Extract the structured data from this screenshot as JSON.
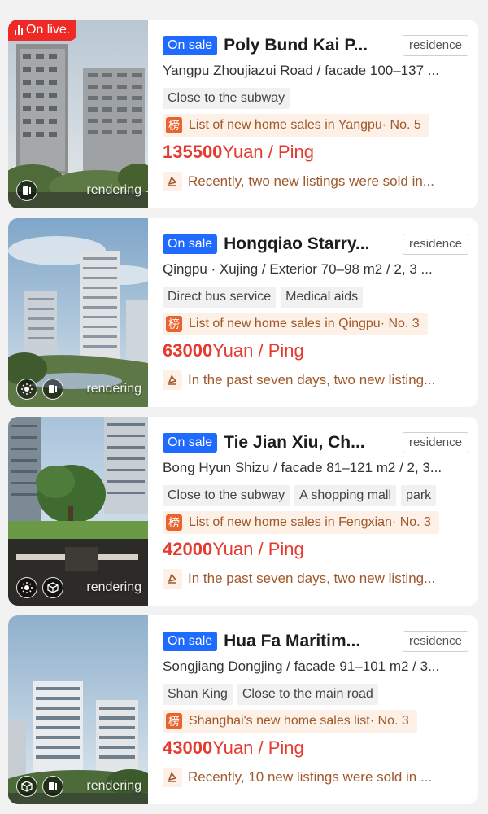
{
  "listings": [
    {
      "live_label": "On live.",
      "render_label": "rendering",
      "status": "On sale",
      "title": "Poly Bund Kai P...",
      "type": "residence",
      "address": "Yangpu Zhoujiazui Road / facade 100–137 ...",
      "tags": [
        "Close to the subway"
      ],
      "rank_icon": "榜",
      "rank_text": "List of new home sales in Yangpu· No. 5",
      "price_value": "135500",
      "price_unit": "Yuan / Ping",
      "news": "Recently, two new listings were sold in..."
    },
    {
      "render_label": "rendering",
      "status": "On sale",
      "title": "Hongqiao Starry...",
      "type": "residence",
      "address": "Qingpu · Xujing / Exterior 70–98 m2 / 2, 3 ...",
      "tags": [
        "Direct bus service",
        "Medical aids"
      ],
      "rank_icon": "榜",
      "rank_text": "List of new home sales in Qingpu· No. 3",
      "price_value": "63000",
      "price_unit": "Yuan / Ping",
      "news": "In the past seven days, two new listing..."
    },
    {
      "render_label": "rendering",
      "status": "On sale",
      "title": "Tie Jian Xiu, Ch...",
      "type": "residence",
      "address": "Bong Hyun Shizu / facade 81–121 m2 / 2, 3...",
      "tags": [
        "Close to the subway",
        "A shopping mall",
        "park"
      ],
      "rank_icon": "榜",
      "rank_text": "List of new home sales in Fengxian· No. 3",
      "price_value": "42000",
      "price_unit": "Yuan / Ping",
      "news": "In the past seven days, two new listing..."
    },
    {
      "render_label": "rendering",
      "status": "On sale",
      "title": "Hua Fa Maritim...",
      "type": "residence",
      "address": "Songjiang Dongjing / facade 91–101 m2 / 3...",
      "tags": [
        "Shan King",
        "Close to the main road"
      ],
      "rank_icon": "榜",
      "rank_text": "Shanghai's new home sales list· No. 3",
      "price_value": "43000",
      "price_unit": "Yuan / Ping",
      "news": "Recently, 10 new listings were sold in ..."
    }
  ],
  "colors": {
    "accent_blue": "#1f6bff",
    "price_red": "#e53a2f",
    "live_red": "#ef2a26",
    "rank_brown": "#a0582b",
    "rank_bg": "#fdf0e6"
  },
  "icons": [
    "live-bars-icon",
    "album-icon",
    "vr-icon",
    "3d-cube-icon",
    "rank-icon",
    "hot-news-icon"
  ]
}
